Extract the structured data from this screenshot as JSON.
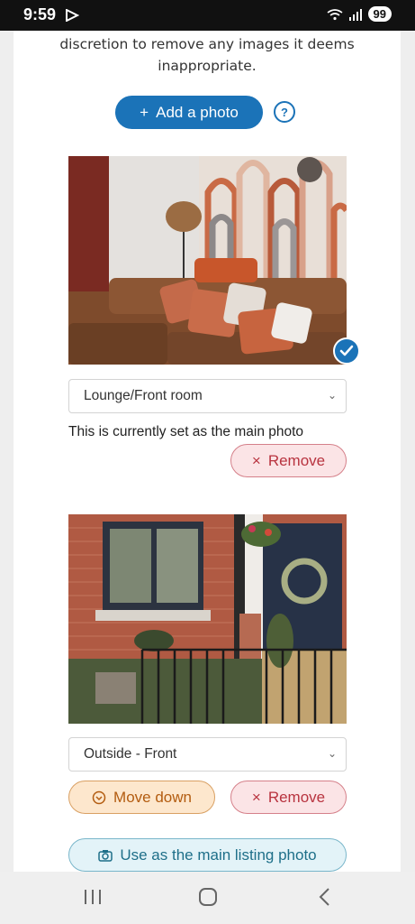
{
  "status_bar": {
    "time": "9:59",
    "battery": "99"
  },
  "intro": {
    "line1": "discretion to remove any images it deems",
    "line2": "inappropriate."
  },
  "add_photo": {
    "label": "Add a photo",
    "icon": "plus-icon"
  },
  "help": {
    "label": "?"
  },
  "photos": [
    {
      "room": "Lounge/Front room",
      "main_note": "This is currently set as the main photo",
      "remove_label": "Remove"
    },
    {
      "room": "Outside - Front",
      "move_down_label": "Move down",
      "remove_label": "Remove",
      "main_photo_label": "Use as the main listing photo"
    }
  ],
  "colors": {
    "primary": "#1b73b8",
    "remove": "#b8333f",
    "move_down": "#b35c10",
    "main_photo": "#1e6f89"
  }
}
